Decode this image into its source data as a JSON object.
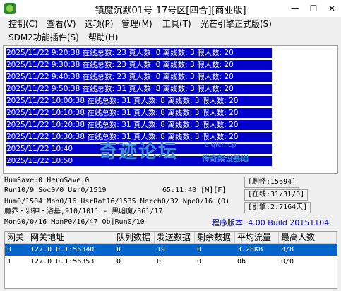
{
  "window": {
    "title": "镇魔沉默01号-17号区[四合][商业版]",
    "minimize": "—",
    "maximize": "☐",
    "close": "✕"
  },
  "menu": {
    "row1": [
      "控制(C)",
      "查看(V)",
      "选项(P)",
      "管理(M)",
      "工具(T)",
      "光芒引擎正式版(S)"
    ],
    "row2": [
      "SDM2功能插件(S)",
      "帮助(H)"
    ]
  },
  "log": [
    "2025/11/22 9:20:38 在线总数: 23 真人数: 0 离线数: 3 假人数: 20",
    "2025/11/22 9:30:38 在线总数: 23 真人数: 0 离线数: 3 假人数: 20",
    "2025/11/22 9:40:38 在线总数: 23 真人数: 0 离线数: 3 假人数: 20",
    "2025/11/22 9:50:38 在线总数: 31 真人数: 8 离线数: 3 假人数: 20",
    "2025/11/22 10:00:38 在线总数: 31 真人数: 8 离线数: 3 假人数: 20",
    "2025/11/22 10:10:38 在线总数: 31 真人数: 8 离线数: 3 假人数: 20",
    "2025/11/22 10:20:38 在线总数: 31 真人数: 8 离线数: 3 假人数: 20",
    "2025/11/22 10:30:38 在线总数: 31 真人数: 8 离线数: 3 假人数: 20",
    "2025/11/22 10:40",
    "2025/11/22 10:50"
  ],
  "watermark": {
    "main": "奇迹论坛",
    "url": "aiqicn.cp",
    "sub": "传奇架设基础"
  },
  "status": {
    "line1": "HumSave:0 HeroSave:0",
    "line2": "Run10/9 Soc0/0 Usr0/1519",
    "clock": "65:11:40 [M][F]",
    "line3": "Hum0/1504 Mon0/16 UsrRot16/1535 Merch0/32 Npc0/16 (0)",
    "line4": "魔界・邪神・浴基,910/1011 - 黑暗魔/361/17",
    "line5": "MonG0/0/16 MonP0/16/47 ObjRun0/10"
  },
  "side": {
    "refresh": "[刷怪:15694]",
    "online": "[在线:31/31/0]",
    "engine": "[引擎:2.7164天]"
  },
  "version": "程序版本: 4.00 Build 20151104",
  "table": {
    "headers": [
      "网关",
      "网关地址",
      "队列数据",
      "发送数据",
      "剩余数据",
      "平均流量",
      "最高人数"
    ],
    "rows": [
      [
        "0",
        "127.0.0.1:56340",
        "0",
        "19",
        "0",
        "3.28KB",
        "8/8"
      ],
      [
        "1",
        "127.0.0.1:56353",
        "0",
        "0",
        "0",
        "0b",
        "0/0"
      ]
    ]
  }
}
